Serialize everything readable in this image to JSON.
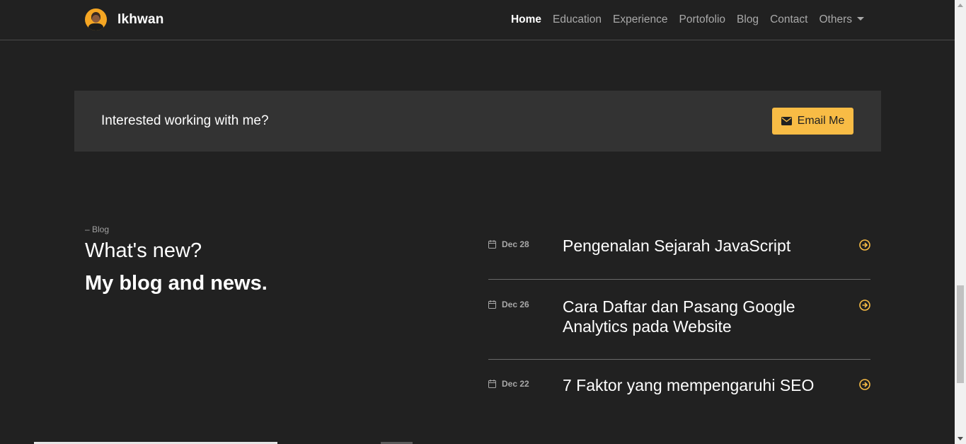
{
  "brand": {
    "name": "Ikhwan",
    "avatar_icon": "avatar-icon"
  },
  "nav": {
    "items": [
      {
        "label": "Home",
        "active": true
      },
      {
        "label": "Education"
      },
      {
        "label": "Experience"
      },
      {
        "label": "Portofolio"
      },
      {
        "label": "Blog"
      },
      {
        "label": "Contact"
      },
      {
        "label": "Others",
        "dropdown": true
      }
    ]
  },
  "cta": {
    "text": "Interested working with me?",
    "button_label": "Email Me",
    "button_icon": "envelope-icon"
  },
  "blog": {
    "eyebrow": "– Blog",
    "heading": "What's new?",
    "subheading": "My blog and news.",
    "posts": [
      {
        "date": "Dec 28",
        "title": "Pengenalan Sejarah JavaScript"
      },
      {
        "date": "Dec 26",
        "title": "Cara Daftar dan Pasang Google Analytics pada Website"
      },
      {
        "date": "Dec 22",
        "title": "7 Faktor yang mempengaruhi SEO"
      }
    ]
  },
  "colors": {
    "background": "#212121",
    "panel": "#333333",
    "accent": "#f8bc45",
    "muted_text": "#a9a9a9"
  }
}
